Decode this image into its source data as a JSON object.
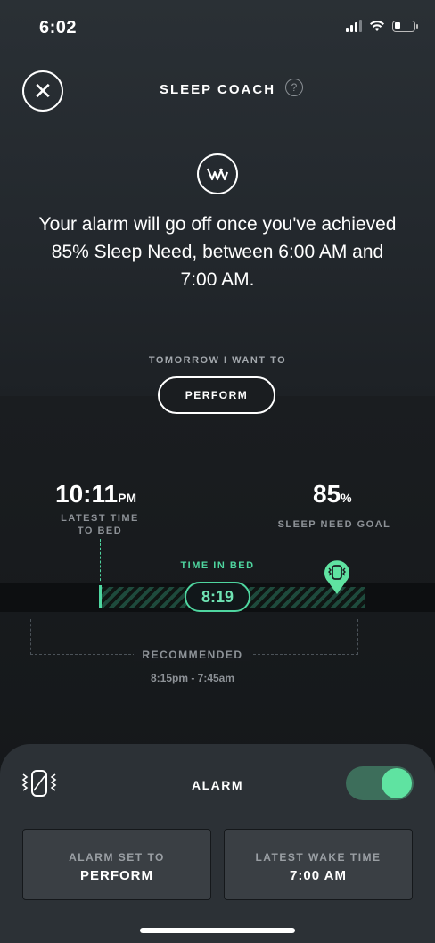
{
  "status_bar": {
    "time": "6:02"
  },
  "header": {
    "title": "SLEEP COACH",
    "help_icon": "?"
  },
  "message": "Your alarm will go off once you've achieved 85% Sleep Need, between 6:00 AM and 7:00 AM.",
  "tomorrow": {
    "label": "TOMORROW I WANT TO",
    "button_label": "PERFORM"
  },
  "bedtime": {
    "value": "10:11",
    "suffix": "PM",
    "label_line1": "LATEST TIME",
    "label_line2": "TO BED"
  },
  "sleep_goal": {
    "value": "85",
    "suffix": "%",
    "label": "SLEEP NEED GOAL"
  },
  "time_in_bed": {
    "label": "TIME IN BED",
    "value": "8:19"
  },
  "recommended": {
    "label": "RECOMMENDED",
    "range": "8:15pm - 7:45am"
  },
  "alarm": {
    "title": "ALARM",
    "enabled": true,
    "accent_color": "#5fe3a1",
    "set_to_label": "ALARM SET TO",
    "set_to_value": "PERFORM",
    "wake_label": "LATEST WAKE TIME",
    "wake_value": "7:00 AM"
  }
}
